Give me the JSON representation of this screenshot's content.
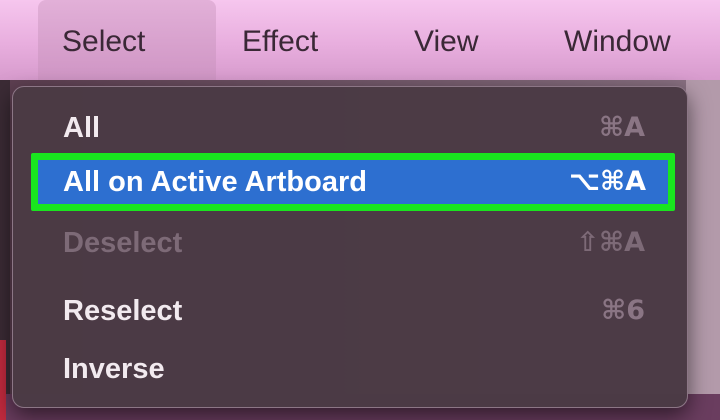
{
  "menubar": {
    "items": [
      "Select",
      "Effect",
      "View",
      "Window"
    ],
    "active_index": 0
  },
  "menu": {
    "items": [
      {
        "label": "All",
        "shortcut": "⌘A",
        "state": "normal"
      },
      {
        "label": "All on Active Artboard",
        "shortcut": "⌥⌘A",
        "state": "highlighted"
      },
      {
        "label": "Deselect",
        "shortcut": "⇧⌘A",
        "state": "disabled"
      },
      {
        "label": "Reselect",
        "shortcut": "⌘6",
        "state": "normal"
      },
      {
        "label": "Inverse",
        "shortcut": "",
        "state": "normal"
      }
    ]
  },
  "colors": {
    "highlight": "#2d6fd0",
    "annotation_outline": "#19e51f",
    "menubar": "#e8aede"
  }
}
